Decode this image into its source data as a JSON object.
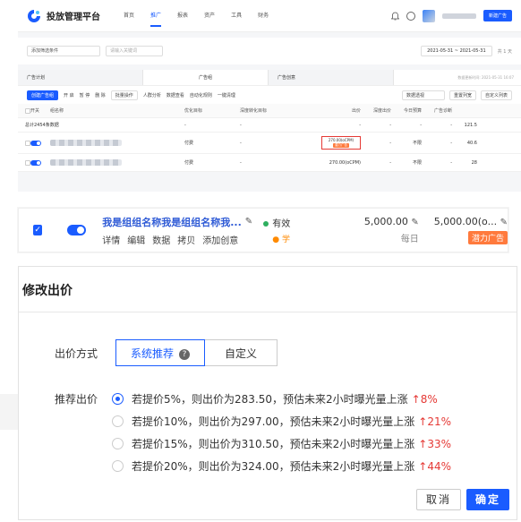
{
  "topnav": {
    "brand": "投放管理平台",
    "items": [
      "首页",
      "推广",
      "报表",
      "资产",
      "工具",
      "财务"
    ],
    "active_index": 1,
    "new_button": "新建广告"
  },
  "filter": {
    "condition_placeholder": "添加筛选条件",
    "search_placeholder": "请输入关键词",
    "date_start": "2021-05-31",
    "date_end": "2021-05-31",
    "date_sep": "~",
    "days": "共 1 天"
  },
  "tabs": [
    "广告计划",
    "广告组",
    "广告创意"
  ],
  "tab_note": "数据更新时间: 2021-05-31 16:07",
  "toolbar": {
    "create": "创建广告组",
    "on": "开 启",
    "pause": "暂 停",
    "delete": "删 除",
    "more": "批量操作",
    "crowd": "人群分析",
    "data": "数据查看",
    "auto": "自动化规则",
    "clean": "一键清理",
    "data_filter": "数据透视",
    "reset_cols": "重置列宽",
    "custom_cols": "自定义列表"
  },
  "table": {
    "headers": [
      "开关",
      "组名称",
      "优化目标",
      "深度转化目标",
      "出价",
      "深度出价",
      "今日预算",
      "广告诊断"
    ],
    "summary": {
      "label": "总计2454条数据",
      "goal": "-",
      "deep": "-",
      "bid": "-",
      "dbid": "-",
      "budget": "-",
      "diag": "-",
      "last": "121.5"
    },
    "rows": [
      {
        "goal": "付费",
        "deep": "-",
        "bid": "270.00(oCPM)",
        "bid_tag": "潜力广告",
        "dbid": "-",
        "budget": "不限",
        "diag": "-",
        "last": "40.6"
      },
      {
        "goal": "付费",
        "deep": "-",
        "bid": "270.00(oCPM)",
        "bid_tag": "",
        "dbid": "-",
        "budget": "不限",
        "diag": "-",
        "last": "28"
      }
    ]
  },
  "row_detail": {
    "name": "我是组组名称我是组组名称我...",
    "actions": [
      "详情",
      "编辑",
      "数据",
      "拷贝",
      "添加创意"
    ],
    "status": "有效",
    "status_note": "学",
    "budget": "5,000.00",
    "budget_period": "每日",
    "bid": "5,000.00(o...",
    "bid_tag": "潜力广告"
  },
  "modal": {
    "title": "修改出价",
    "mode_label": "出价方式",
    "mode_options": [
      "系统推荐",
      "自定义"
    ],
    "rec_label": "推荐出价",
    "options": [
      {
        "text": "若提价5%，则出价为283.50，预估未来2小时曝光量上涨",
        "rise": "8%"
      },
      {
        "text": "若提价10%，则出价为297.00，预估未来2小时曝光量上涨",
        "rise": "21%"
      },
      {
        "text": "若提价15%，则出价为310.50，预估未来2小时曝光量上涨",
        "rise": "33%"
      },
      {
        "text": "若提价20%，则出价为324.00，预估未来2小时曝光量上涨",
        "rise": "44%"
      }
    ],
    "selected_index": 0,
    "cancel": "取消",
    "ok": "确定"
  },
  "colors": {
    "primary": "#1a5cff",
    "danger": "#e53935",
    "orange": "#ff7a3d",
    "green": "#2eaf5f"
  }
}
